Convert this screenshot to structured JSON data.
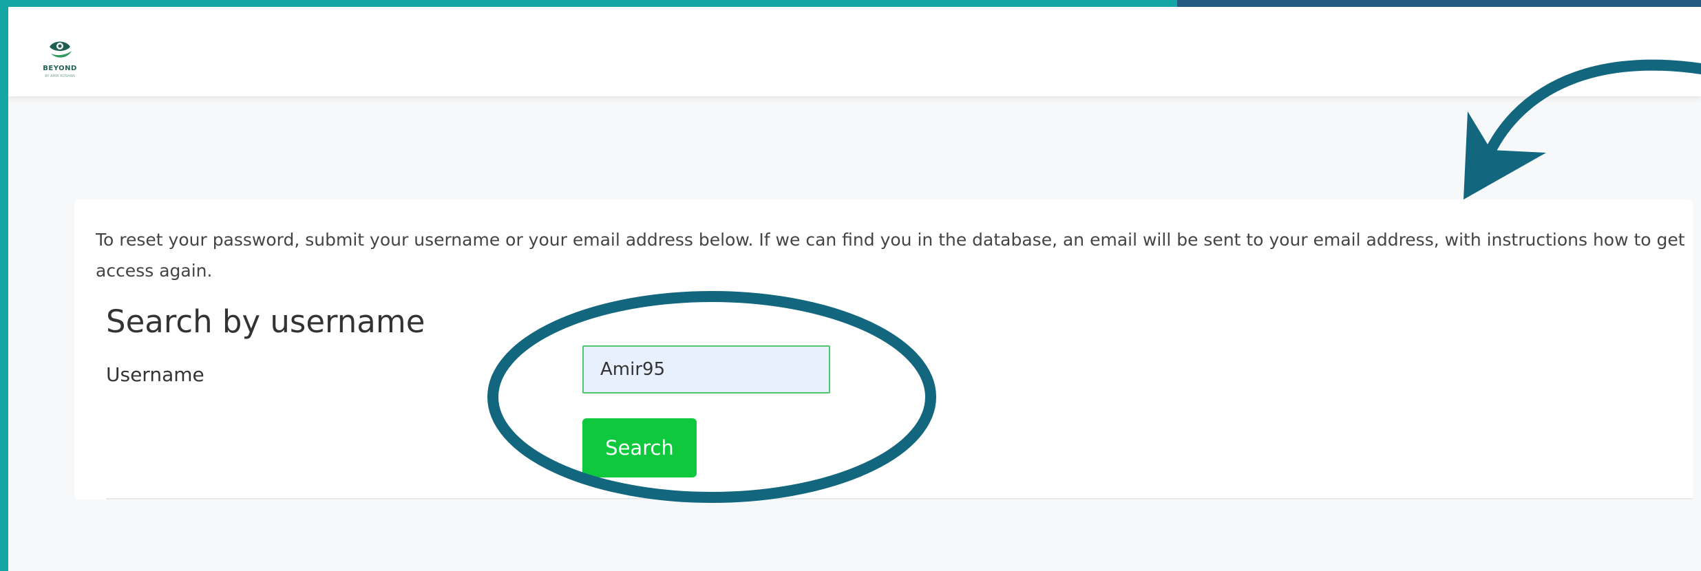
{
  "branding": {
    "logo_text": "BEYOND",
    "logo_subtext": "BY AMIR ROSHAN"
  },
  "form": {
    "instructions": "To reset your password, submit your username or your email address below. If we can find you in the database, an email will be sent to your email address, with instructions how to get access again.",
    "section_heading": "Search by username",
    "username_label": "Username",
    "username_value": "Amir95",
    "search_button_label": "Search"
  },
  "colors": {
    "page_border": "#13a6a4",
    "top_accent": "#235b84",
    "button": "#10c83e",
    "input_border": "#4fc66d",
    "input_bg": "#e8f0fe",
    "annotation": "#12667d"
  },
  "icons": {
    "logo": "eye-leaf-logo-icon",
    "annotation_arrow": "curved-arrow-icon",
    "annotation_circle": "highlight-ellipse"
  }
}
